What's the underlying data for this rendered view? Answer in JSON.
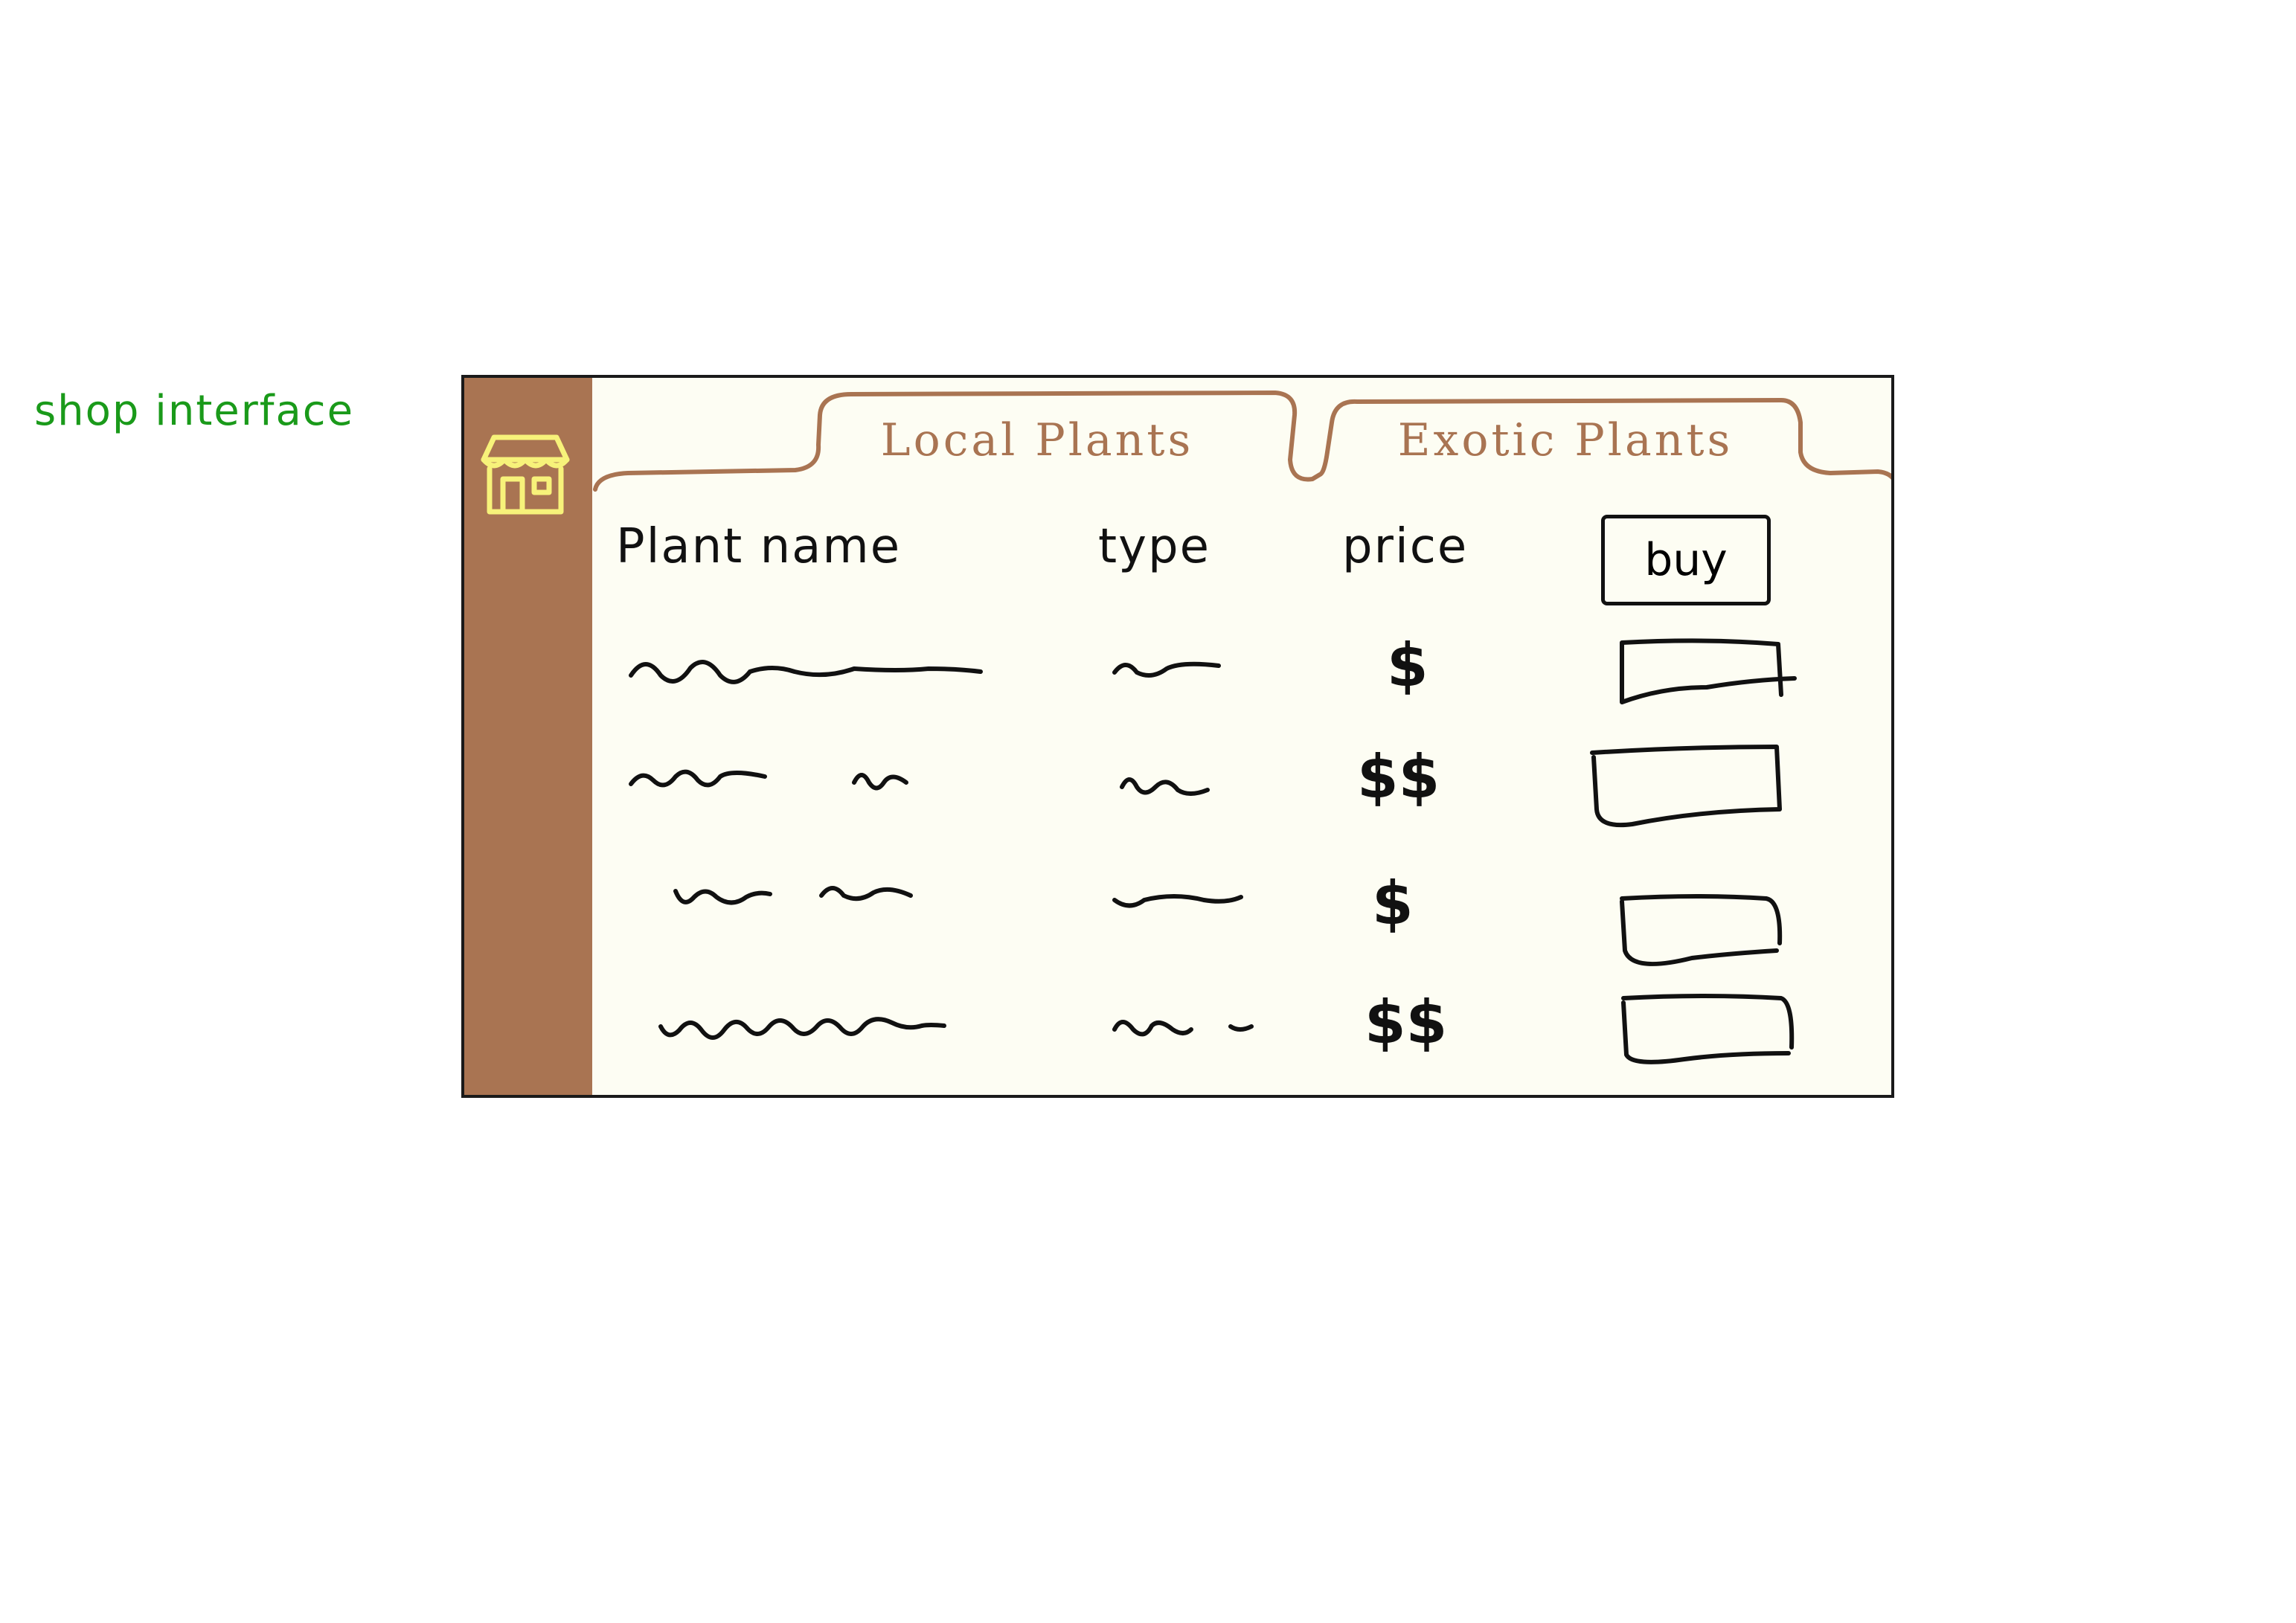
{
  "caption": "shop interface",
  "colors": {
    "caption": "#1a9a1a",
    "sidebar": "#a97452",
    "icon": "#f7f27a",
    "tab_text": "#a97452",
    "tab_outline": "#a97452",
    "window_bg": "#fdfdf3",
    "ink": "#111111"
  },
  "sidebar": {
    "icon": "storefront-icon"
  },
  "tabs": [
    {
      "label": "Local Plants"
    },
    {
      "label": "Exotic Plants"
    }
  ],
  "table": {
    "headers": {
      "name": "Plant name",
      "type": "type",
      "price": "price",
      "buy": "buy"
    },
    "rows": [
      {
        "price": "$"
      },
      {
        "price": "$$"
      },
      {
        "price": "$"
      },
      {
        "price": "$$"
      }
    ]
  }
}
